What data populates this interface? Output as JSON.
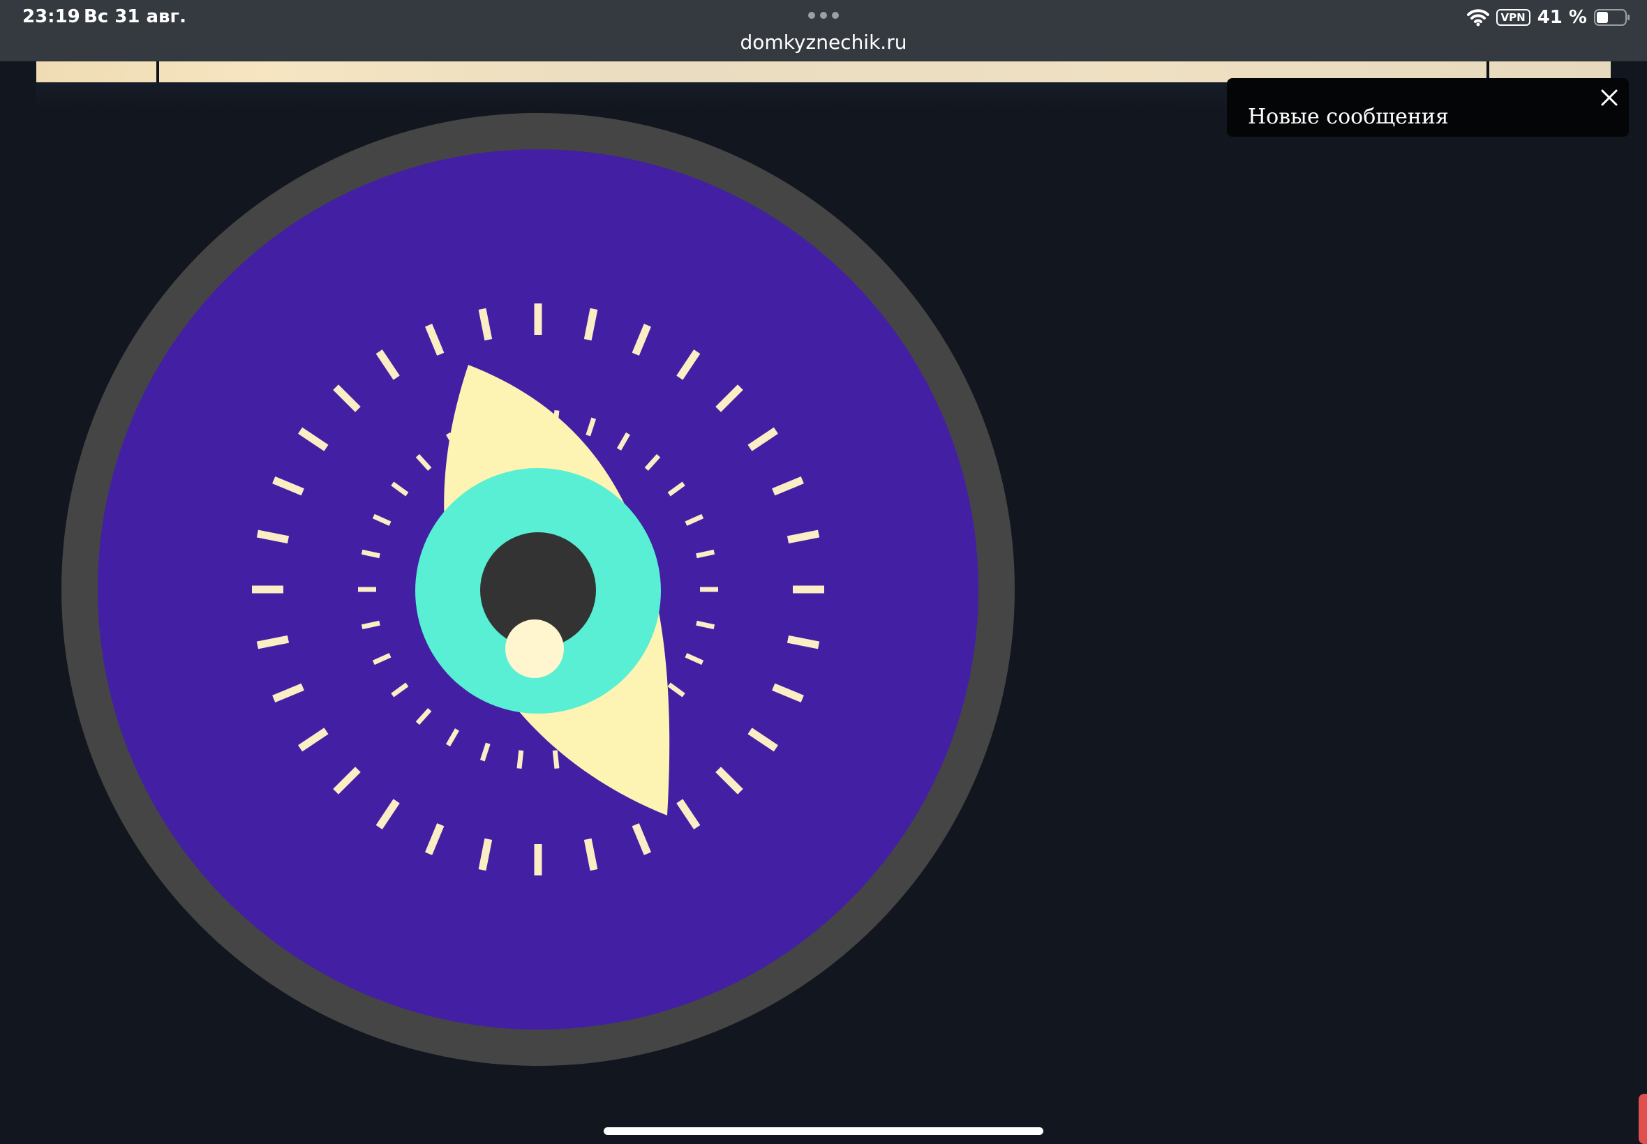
{
  "status_bar": {
    "time": "23:19",
    "date": "Вс 31 авг.",
    "vpn": "VPN",
    "battery": "41 %",
    "battery_level": 0.41
  },
  "browser": {
    "url": "domkyznechik.ru"
  },
  "toast": {
    "text": "Новые сообщения"
  },
  "colors": {
    "page_bg": "#12161e",
    "ring": "#454545",
    "disc": "#431fa3",
    "eye_white": "#fdf3b2",
    "iris": "#58efd4",
    "pupil": "#333333",
    "highlight": "#fff5cf",
    "tick": "#fbeec4"
  },
  "icons": {
    "wifi": "wifi-icon",
    "battery": "battery-icon",
    "close": "close-icon",
    "more": "more-dots-icon"
  }
}
